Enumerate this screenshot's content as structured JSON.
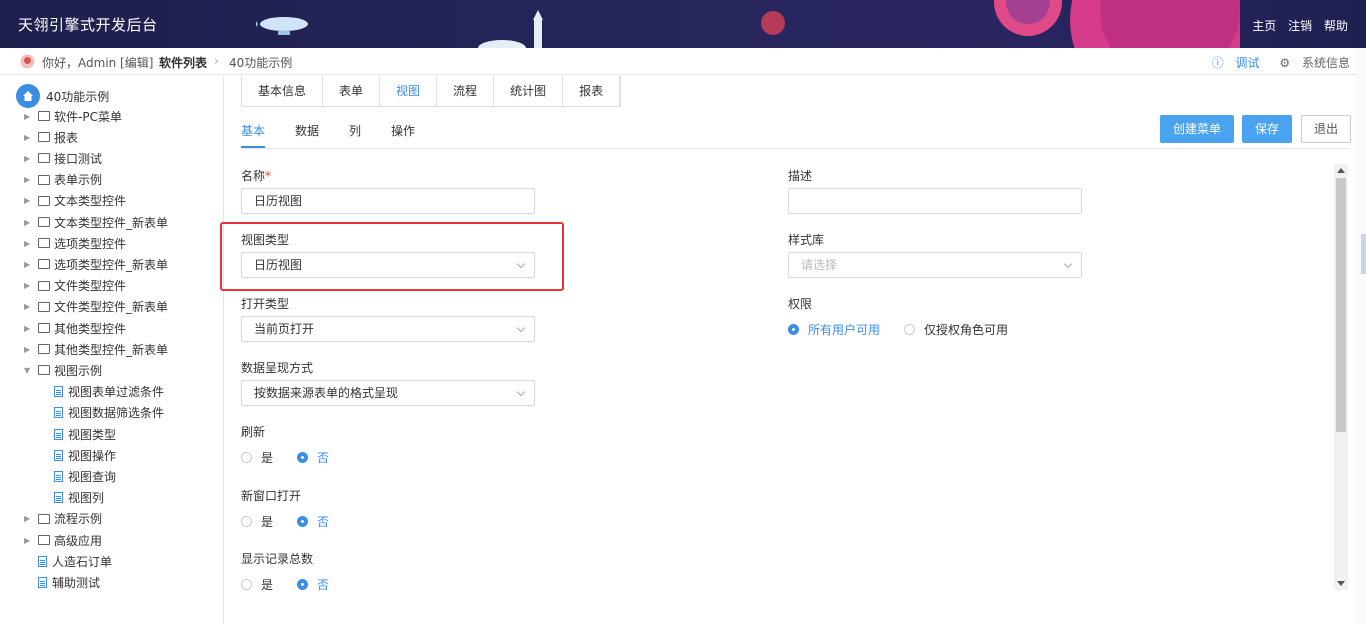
{
  "header": {
    "title": "天翎引擎式开发后台",
    "links": [
      "主页",
      "注销",
      "帮助"
    ]
  },
  "breadcrumb": {
    "greeting": "你好，Admin [编辑]",
    "crumb1": "软件列表",
    "crumb2": "40功能示例",
    "debug": "调试",
    "sysinfo": "系统信息"
  },
  "sidebar": {
    "root": "40功能示例",
    "items": [
      {
        "label": "软件-PC菜单",
        "type": "folder"
      },
      {
        "label": "报表",
        "type": "folder"
      },
      {
        "label": "接口测试",
        "type": "folder"
      },
      {
        "label": "表单示例",
        "type": "folder"
      },
      {
        "label": "文本类型控件",
        "type": "folder"
      },
      {
        "label": "文本类型控件_新表单",
        "type": "folder"
      },
      {
        "label": "选项类型控件",
        "type": "folder"
      },
      {
        "label": "选项类型控件_新表单",
        "type": "folder"
      },
      {
        "label": "文件类型控件",
        "type": "folder"
      },
      {
        "label": "文件类型控件_新表单",
        "type": "folder"
      },
      {
        "label": "其他类型控件",
        "type": "folder"
      },
      {
        "label": "其他类型控件_新表单",
        "type": "folder"
      },
      {
        "label": "视图示例",
        "type": "folder-open"
      },
      {
        "label": "视图表单过滤条件",
        "type": "doc"
      },
      {
        "label": "视图数据筛选条件",
        "type": "doc"
      },
      {
        "label": "视图类型",
        "type": "doc"
      },
      {
        "label": "视图操作",
        "type": "doc"
      },
      {
        "label": "视图查询",
        "type": "doc"
      },
      {
        "label": "视图列",
        "type": "doc"
      },
      {
        "label": "流程示例",
        "type": "folder"
      },
      {
        "label": "高级应用",
        "type": "folder"
      },
      {
        "label": "人造石订单",
        "type": "doc-root"
      },
      {
        "label": "辅助测试",
        "type": "doc-root"
      }
    ]
  },
  "tabs": [
    "基本信息",
    "表单",
    "视图",
    "流程",
    "统计图",
    "报表"
  ],
  "active_tab": "视图",
  "subtabs": [
    "基本",
    "数据",
    "列",
    "操作"
  ],
  "active_subtab": "基本",
  "buttons": {
    "create_menu": "创建菜单",
    "save": "保存",
    "exit": "退出"
  },
  "form": {
    "name_label": "名称",
    "name_required": "*",
    "name_value": "日历视图",
    "desc_label": "描述",
    "desc_value": "",
    "view_type_label": "视图类型",
    "view_type_value": "日历视图",
    "style_label": "样式库",
    "style_placeholder": "请选择",
    "open_type_label": "打开类型",
    "open_type_value": "当前页打开",
    "perm_label": "权限",
    "perm_options": [
      "所有用户可用",
      "仅授权角色可用"
    ],
    "perm_selected": 0,
    "data_mode_label": "数据呈现方式",
    "data_mode_value": "按数据来源表单的格式呈现",
    "refresh_label": "刷新",
    "new_window_label": "新窗口打开",
    "show_total_label": "显示记录总数",
    "yes": "是",
    "no": "否"
  },
  "colors": {
    "accent": "#3a8ee6",
    "primary_button": "#4aa3ef",
    "highlight": "#e8313a",
    "header_bg": "#25255a"
  }
}
